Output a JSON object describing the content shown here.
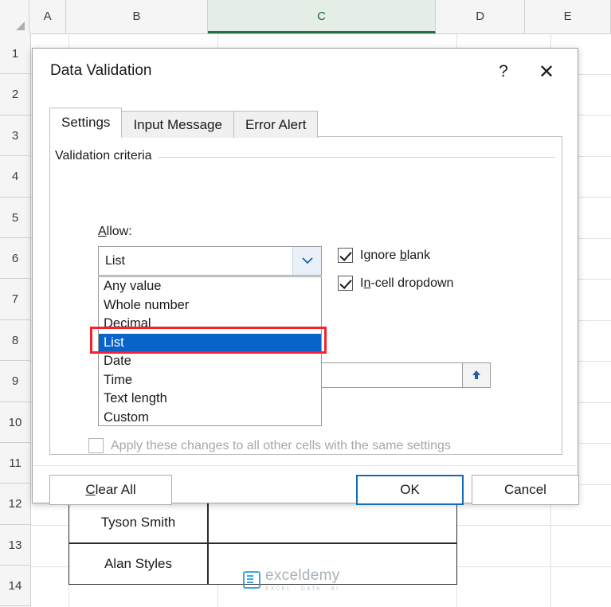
{
  "spreadsheet": {
    "column_headers": [
      "A",
      "B",
      "C",
      "D",
      "E"
    ],
    "selected_column": "C",
    "row_headers": [
      "1",
      "2",
      "3",
      "4",
      "5",
      "6",
      "7",
      "8",
      "9",
      "10",
      "11",
      "12",
      "13",
      "14"
    ],
    "cells": [
      {
        "text": "Tyson Smith"
      },
      {
        "text": "Alan Styles"
      }
    ],
    "watermark": {
      "name": "exceldemy",
      "tagline": "EXCEL · DATA · BI"
    }
  },
  "dialog": {
    "title": "Data Validation",
    "help_label": "?",
    "close_label": "✕",
    "tabs": [
      {
        "label": "Settings",
        "active": true
      },
      {
        "label": "Input Message",
        "active": false
      },
      {
        "label": "Error Alert",
        "active": false
      }
    ],
    "group_label": "Validation criteria",
    "allow_label": "Allow:",
    "allow_value": "List",
    "dropdown_items": [
      "Any value",
      "Whole number",
      "Decimal",
      "List",
      "Date",
      "Time",
      "Text length",
      "Custom"
    ],
    "dropdown_selected": "List",
    "highlight_color": "#f5222d",
    "checkboxes": [
      {
        "label_pre": "Ignore ",
        "label_key": "b",
        "label_post": "lank",
        "checked": true,
        "disabled": false
      },
      {
        "label_pre": "I",
        "label_key": "n",
        "label_post": "-cell dropdown",
        "checked": true,
        "disabled": false
      }
    ],
    "apply_all": {
      "label": "Apply these changes to all other cells with the same settings",
      "checked": false,
      "disabled": true
    },
    "source_value": "",
    "source_picker_icon": "range-picker-icon",
    "buttons": [
      {
        "name": "clear-all-button",
        "pre": "C",
        "key": "l",
        "post": "ear All",
        "primary": false
      },
      {
        "name": "ok-button",
        "pre": "OK",
        "key": "",
        "post": "",
        "primary": true
      },
      {
        "name": "cancel-button",
        "pre": "Cancel",
        "key": "",
        "post": "",
        "primary": false
      }
    ]
  }
}
